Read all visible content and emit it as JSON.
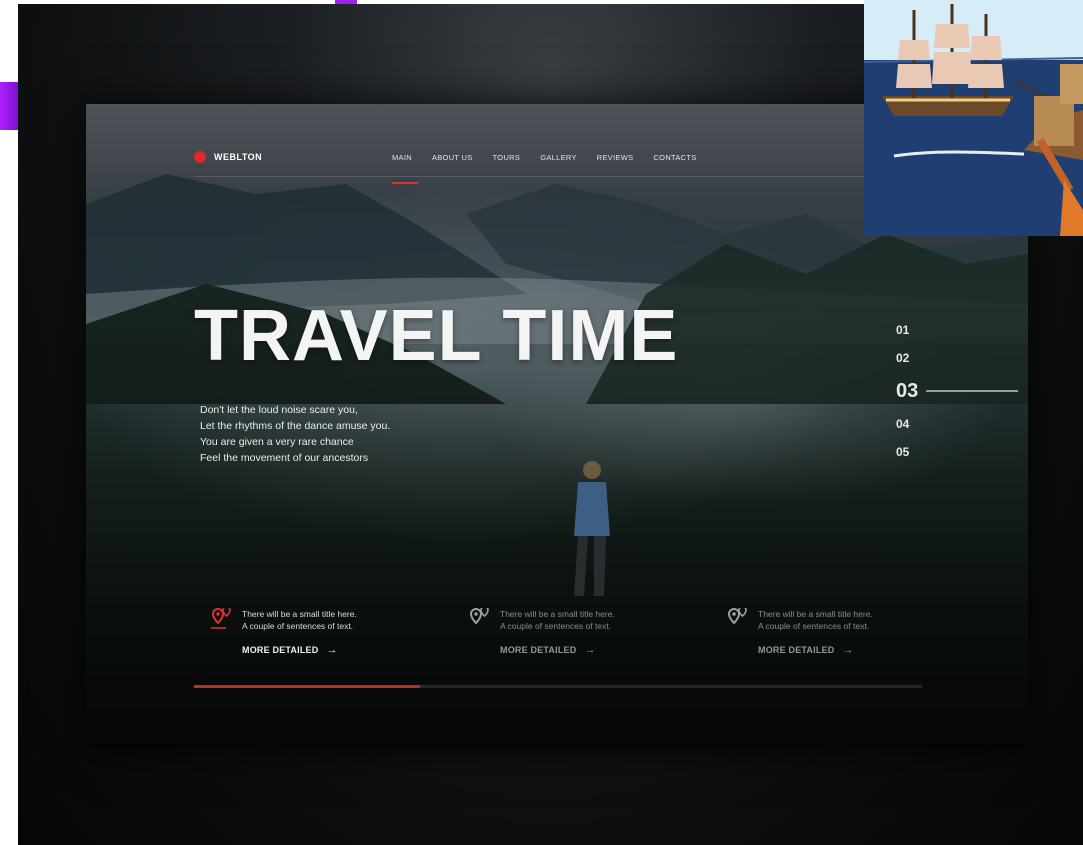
{
  "colors": {
    "accent": "#d83232",
    "background": "#0c0e0f",
    "text": "#f4f4f4"
  },
  "logo": {
    "name": "WEBLTON",
    "icon": "red-dot-icon"
  },
  "nav": {
    "items": [
      {
        "label": "MAIN",
        "active": true
      },
      {
        "label": "ABOUT US",
        "active": false
      },
      {
        "label": "TOURS",
        "active": false
      },
      {
        "label": "GALLERY",
        "active": false
      },
      {
        "label": "REVIEWS",
        "active": false
      },
      {
        "label": "CONTACTS",
        "active": false
      }
    ]
  },
  "hero": {
    "title": "TRAVEL TIME",
    "lines": [
      "Don't let the loud noise scare you,",
      "Let the rhythms of the dance amuse you.",
      "You are given a very rare chance",
      "Feel the movement of our ancestors"
    ]
  },
  "slider": {
    "numbers": [
      "01",
      "02",
      "03",
      "04",
      "05"
    ],
    "active_index": 2
  },
  "features": [
    {
      "line1": "There will be a small title here.",
      "line2": "A couple of sentences of text.",
      "link": "MORE DETAILED",
      "arrow": "→",
      "icon": "map-pin-icon"
    },
    {
      "line1": "There will be a small title here.",
      "line2": "A couple of sentences of text.",
      "link": "MORE DETAILED",
      "arrow": "→",
      "icon": "map-pin-icon"
    },
    {
      "line1": "There will be a small title here.",
      "line2": "A couple of sentences of text.",
      "link": "MORE DETAILED",
      "arrow": "→",
      "icon": "map-pin-icon"
    }
  ],
  "progress": {
    "fraction": 0.31
  },
  "inset_image": {
    "icon": "sailing-ship-illustration"
  }
}
